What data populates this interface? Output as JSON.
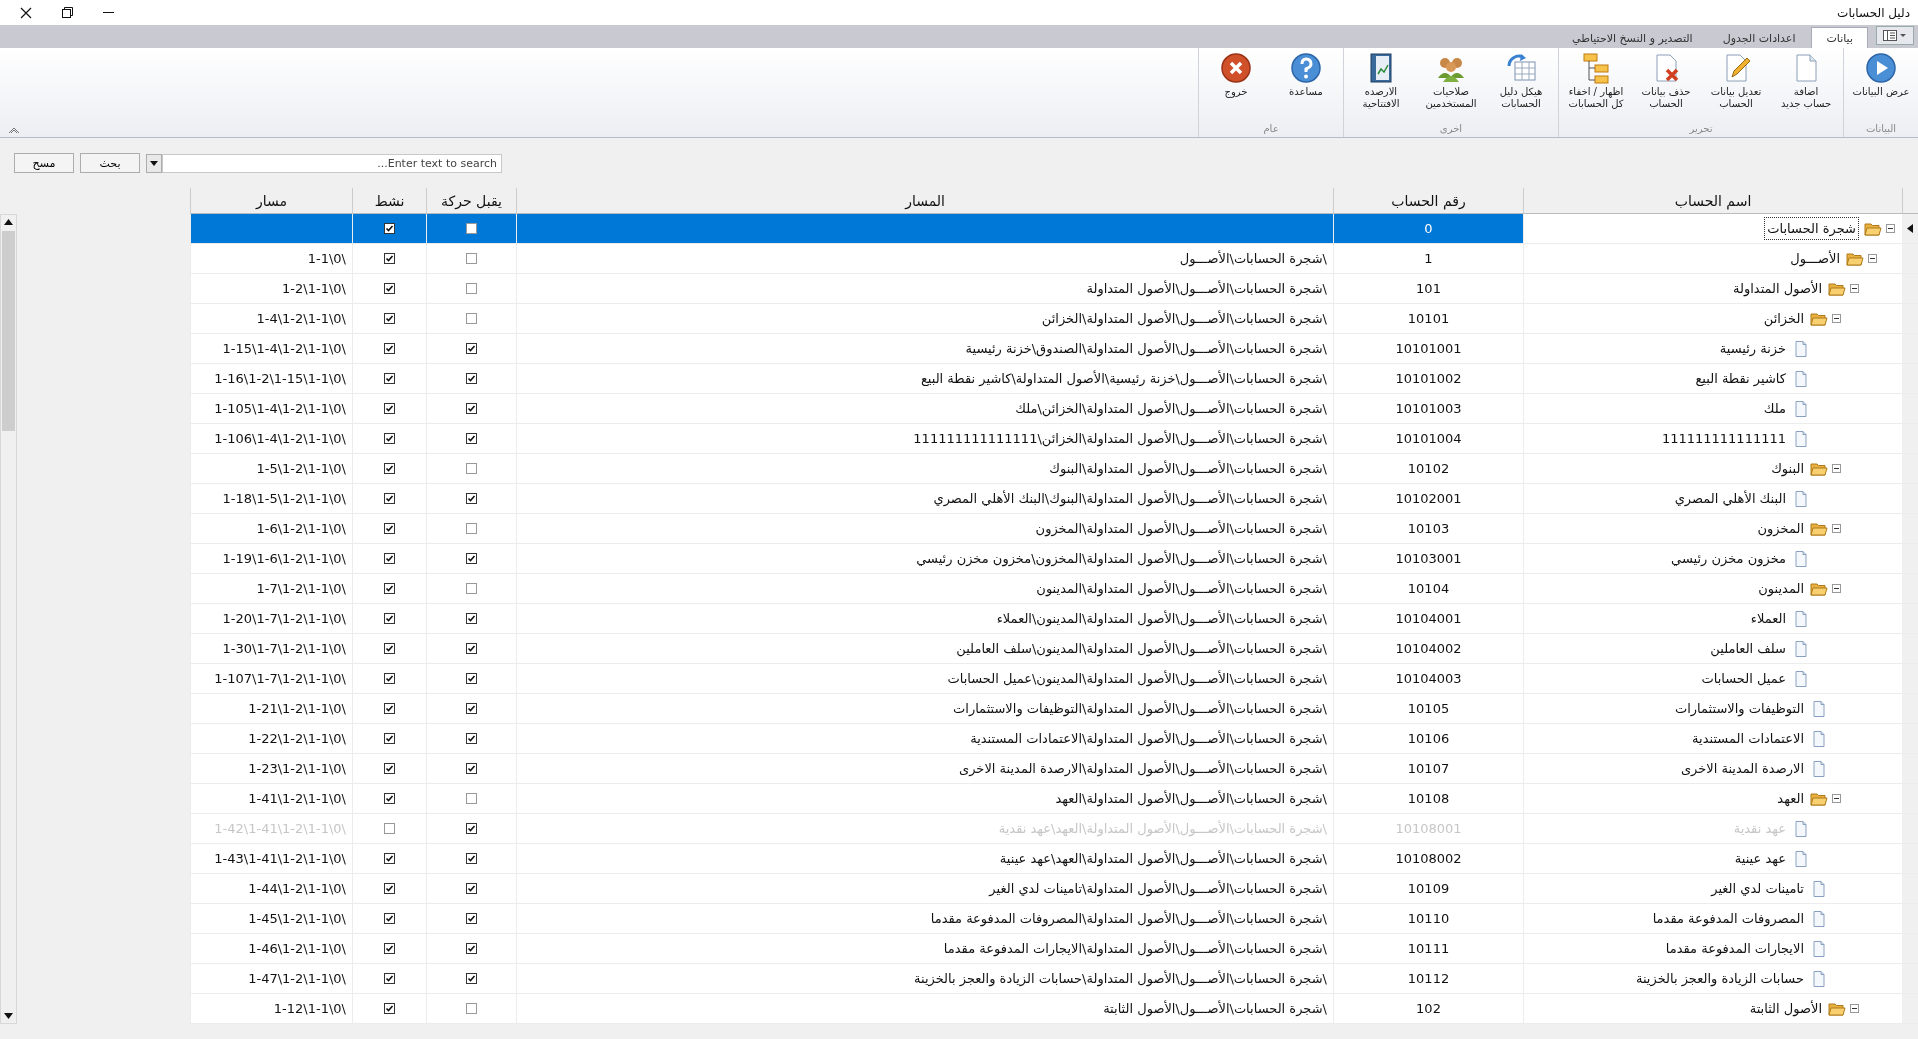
{
  "window": {
    "title": "دليل الحسابات"
  },
  "ribbon": {
    "tabs": [
      {
        "label": "بيانات",
        "selected": true
      },
      {
        "label": "اعدادات الجدول",
        "selected": false
      },
      {
        "label": "التصدير و النسخ الاحتياطي",
        "selected": false
      }
    ],
    "groups": [
      {
        "label": "البيانات",
        "buttons": [
          {
            "label": "عرض البيانات",
            "kind": "play"
          }
        ]
      },
      {
        "label": "تحرير",
        "buttons": [
          {
            "label": "اضافة\nحساب جديد",
            "kind": "new"
          },
          {
            "label": "تعديل بيانات\nالحساب",
            "kind": "edit"
          },
          {
            "label": "حذف بيانات\nالحساب",
            "kind": "delete"
          },
          {
            "label": "اظهار / اخفاء\nكل الحسابات",
            "kind": "tree"
          }
        ]
      },
      {
        "label": "اخرى",
        "buttons": [
          {
            "label": "هيكل دليل\nالحسابات",
            "kind": "structure"
          },
          {
            "label": "صلاحيات\nالمستخدمين",
            "kind": "users"
          },
          {
            "label": "الارصده\nالافتتاحية",
            "kind": "book"
          }
        ]
      },
      {
        "label": "عام",
        "buttons": [
          {
            "label": "مساعدة",
            "kind": "help"
          },
          {
            "label": "خروج",
            "kind": "exit"
          }
        ]
      }
    ]
  },
  "search": {
    "placeholder": "Enter text to search...",
    "buttons": [
      "بحث",
      "مسح"
    ]
  },
  "table": {
    "columns": [
      "اسم الحساب",
      "رقم الحساب",
      "المسار",
      "يقبل حركة",
      "نشط",
      "مسار"
    ],
    "rows": [
      {
        "name": "شجرة الحسابات",
        "number": "0",
        "allows_posting": false,
        "active": true,
        "kind": "folder",
        "expanded": true,
        "selected": true,
        "children": [
          {
            "name": "الأصـــول",
            "number": "1",
            "path": "\\شجرة الحسابات\\الأصـــول",
            "mask": "\\0\\1-1",
            "allows_posting": false,
            "active": true,
            "kind": "folder",
            "expanded": true,
            "selected": false,
            "children": [
              {
                "name": "الأصول المتداولة",
                "number": "101",
                "path": "\\شجرة الحسابات\\الأصـــول\\الأصول المتداولة",
                "mask": "\\0\\1-1\\1-2",
                "allows_posting": false,
                "active": true,
                "kind": "folder",
                "expanded": true,
                "selected": false,
                "children": [
                  {
                    "name": "الخزائن",
                    "number": "10101",
                    "path": "\\شجرة الحسابات\\الأصـــول\\الأصول المتداولة\\الخزائن",
                    "mask": "\\0\\1-1\\1-2\\1-4",
                    "allows_posting": false,
                    "active": true,
                    "kind": "folder",
                    "expanded": true,
                    "selected": false,
                    "children": [
                      {
                        "name": "خزنة رئيسية",
                        "number": "10101001",
                        "path": "\\شجرة الحسابات\\الأصـــول\\الأصول المتداولة\\الصندوق\\خزنة رئيسية",
                        "mask": "\\0\\1-1\\1-2\\1-4\\1-15",
                        "allows_posting": true,
                        "active": true,
                        "kind": "file",
                        "expanded": false,
                        "selected": false
                      },
                      {
                        "name": "كاشير نقطة البيع",
                        "number": "10101002",
                        "path": "\\شجرة الحسابات\\الأصـــول\\خزنة رئيسية\\الأصول المتداولة\\كاشير نقطة البيع",
                        "mask": "\\0\\1-1\\1-15\\1-2\\1-16",
                        "allows_posting": true,
                        "active": true,
                        "kind": "file",
                        "expanded": false,
                        "selected": false
                      },
                      {
                        "name": "ملك",
                        "number": "10101003",
                        "path": "\\شجرة الحسابات\\الأصـــول\\الأصول المتداولة\\الخزائن\\ملك",
                        "mask": "\\0\\1-1\\1-2\\1-4\\1-105",
                        "allows_posting": true,
                        "active": true,
                        "kind": "file",
                        "expanded": false,
                        "selected": false
                      },
                      {
                        "name": "111111111111111",
                        "number": "10101004",
                        "path": "\\شجرة الحسابات\\الأصـــول\\الأصول المتداولة\\الخزائن\\111111111111111",
                        "mask": "\\0\\1-1\\1-2\\1-4\\1-106",
                        "allows_posting": true,
                        "active": true,
                        "kind": "file",
                        "expanded": false,
                        "selected": false
                      }
                    ]
                  },
                  {
                    "name": "البنوك",
                    "number": "10102",
                    "path": "\\شجرة الحسابات\\الأصـــول\\الأصول المتداولة\\البنوك",
                    "mask": "\\0\\1-1\\1-2\\1-5",
                    "allows_posting": false,
                    "active": true,
                    "kind": "folder",
                    "expanded": true,
                    "selected": false,
                    "children": [
                      {
                        "name": "البنك الأهلي المصري",
                        "number": "10102001",
                        "path": "\\شجرة الحسابات\\الأصـــول\\الأصول المتداولة\\البنوك\\البنك الأهلي المصري",
                        "mask": "\\0\\1-1\\1-2\\1-5\\1-18",
                        "allows_posting": true,
                        "active": true,
                        "kind": "file",
                        "expanded": false,
                        "selected": false
                      }
                    ]
                  },
                  {
                    "name": "المخزون",
                    "number": "10103",
                    "path": "\\شجرة الحسابات\\الأصـــول\\الأصول المتداولة\\المخزون",
                    "mask": "\\0\\1-1\\1-2\\1-6",
                    "allows_posting": false,
                    "active": true,
                    "kind": "folder",
                    "expanded": true,
                    "selected": false,
                    "children": [
                      {
                        "name": "مخزون مخزن رئيسي",
                        "number": "10103001",
                        "path": "\\شجرة الحسابات\\الأصـــول\\الأصول المتداولة\\المخزون\\مخزون مخزن رئيسي",
                        "mask": "\\0\\1-1\\1-2\\1-6\\1-19",
                        "allows_posting": true,
                        "active": true,
                        "kind": "file",
                        "expanded": false,
                        "selected": false
                      }
                    ]
                  },
                  {
                    "name": "المدينون",
                    "number": "10104",
                    "path": "\\شجرة الحسابات\\الأصـــول\\الأصول المتداولة\\المدينون",
                    "mask": "\\0\\1-1\\1-2\\1-7",
                    "allows_posting": false,
                    "active": true,
                    "kind": "folder",
                    "expanded": true,
                    "selected": false,
                    "children": [
                      {
                        "name": "العملاء",
                        "number": "10104001",
                        "path": "\\شجرة الحسابات\\الأصـــول\\الأصول المتداولة\\المدينون\\العملاء",
                        "mask": "\\0\\1-1\\1-2\\1-7\\1-20",
                        "allows_posting": true,
                        "active": true,
                        "kind": "file",
                        "expanded": false,
                        "selected": false
                      },
                      {
                        "name": "سلف العاملين",
                        "number": "10104002",
                        "path": "\\شجرة الحسابات\\الأصـــول\\الأصول المتداولة\\المدينون\\سلف العاملين",
                        "mask": "\\0\\1-1\\1-2\\1-7\\1-30",
                        "allows_posting": true,
                        "active": true,
                        "kind": "file",
                        "expanded": false,
                        "selected": false
                      },
                      {
                        "name": "عميل الحسابات",
                        "number": "10104003",
                        "path": "\\شجرة الحسابات\\الأصـــول\\الأصول المتداولة\\المدينون\\عميل الحسابات",
                        "mask": "\\0\\1-1\\1-2\\1-7\\1-107",
                        "allows_posting": true,
                        "active": true,
                        "kind": "file",
                        "expanded": false,
                        "selected": false
                      }
                    ]
                  },
                  {
                    "name": "التوظيفات والاستثمارات",
                    "number": "10105",
                    "path": "\\شجرة الحسابات\\الأصـــول\\الأصول المتداولة\\التوظيفات والاستثمارات",
                    "mask": "\\0\\1-1\\1-2\\1-21",
                    "allows_posting": true,
                    "active": true,
                    "kind": "file",
                    "expanded": false,
                    "selected": false
                  },
                  {
                    "name": "الاعتمادات المستندية",
                    "number": "10106",
                    "path": "\\شجرة الحسابات\\الأصـــول\\الأصول المتداولة\\الاعتمادات المستندية",
                    "mask": "\\0\\1-1\\1-2\\1-22",
                    "allows_posting": true,
                    "active": true,
                    "kind": "file",
                    "expanded": false,
                    "selected": false
                  },
                  {
                    "name": "الارصدة المدينة الاخرى",
                    "number": "10107",
                    "path": "\\شجرة الحسابات\\الأصـــول\\الأصول المتداولة\\الارصدة المدينة الاخرى",
                    "mask": "\\0\\1-1\\1-2\\1-23",
                    "allows_posting": true,
                    "active": true,
                    "kind": "file",
                    "expanded": false,
                    "selected": false
                  },
                  {
                    "name": "العهد",
                    "number": "10108",
                    "path": "\\شجرة الحسابات\\الأصـــول\\الأصول المتداولة\\العهد",
                    "mask": "\\0\\1-1\\1-2\\1-41",
                    "allows_posting": false,
                    "active": true,
                    "kind": "folder",
                    "expanded": true,
                    "selected": false,
                    "children": [
                      {
                        "name": "عهد نقدية",
                        "number": "10108001",
                        "path": "\\شجرة الحسابات\\الأصـــول\\الأصول المتداولة\\العهد\\عهد نقدية",
                        "mask": "\\0\\1-1\\1-2\\1-41\\1-42",
                        "allows_posting": true,
                        "active": false,
                        "kind": "file",
                        "expanded": false,
                        "selected": false
                      },
                      {
                        "name": "عهد عينية",
                        "number": "10108002",
                        "path": "\\شجرة الحسابات\\الأصـــول\\الأصول المتداولة\\العهد\\عهد عينية",
                        "mask": "\\0\\1-1\\1-2\\1-41\\1-43",
                        "allows_posting": true,
                        "active": true,
                        "kind": "file",
                        "expanded": false,
                        "selected": false
                      }
                    ]
                  },
                  {
                    "name": "تامينات لدي الغير",
                    "number": "10109",
                    "path": "\\شجرة الحسابات\\الأصـــول\\الأصول المتداولة\\تامينات لدي الغير",
                    "mask": "\\0\\1-1\\1-2\\1-44",
                    "allows_posting": true,
                    "active": true,
                    "kind": "file",
                    "expanded": false,
                    "selected": false
                  },
                  {
                    "name": "المصروفات المدفوعة مقدما",
                    "number": "10110",
                    "path": "\\شجرة الحسابات\\الأصـــول\\الأصول المتداولة\\المصروفات المدفوعة مقدما",
                    "mask": "\\0\\1-1\\1-2\\1-45",
                    "allows_posting": true,
                    "active": true,
                    "kind": "file",
                    "expanded": false,
                    "selected": false
                  },
                  {
                    "name": "الايجارات المدفوعة مقدما",
                    "number": "10111",
                    "path": "\\شجرة الحسابات\\الأصـــول\\الأصول المتداولة\\الايجارات المدفوعة مقدما",
                    "mask": "\\0\\1-1\\1-2\\1-46",
                    "allows_posting": true,
                    "active": true,
                    "kind": "file",
                    "expanded": false,
                    "selected": false
                  },
                  {
                    "name": "حسابات الزيادة والعجز بالخزينة",
                    "number": "10112",
                    "path": "\\شجرة الحسابات\\الأصـــول\\الأصول المتداولة\\حسابات الزيادة والعجز بالخزينة",
                    "mask": "\\0\\1-1\\1-2\\1-47",
                    "allows_posting": true,
                    "active": true,
                    "kind": "file",
                    "expanded": false,
                    "selected": false
                  }
                ]
              },
              {
                "name": "الأصول الثابتة",
                "number": "102",
                "path": "\\شجرة الحسابات\\الأصـــول\\الأصول الثابتة",
                "mask": "\\0\\1-1\\1-12",
                "allows_posting": false,
                "active": true,
                "kind": "folder",
                "expanded": true,
                "selected": false
              }
            ]
          }
        ]
      }
    ]
  }
}
